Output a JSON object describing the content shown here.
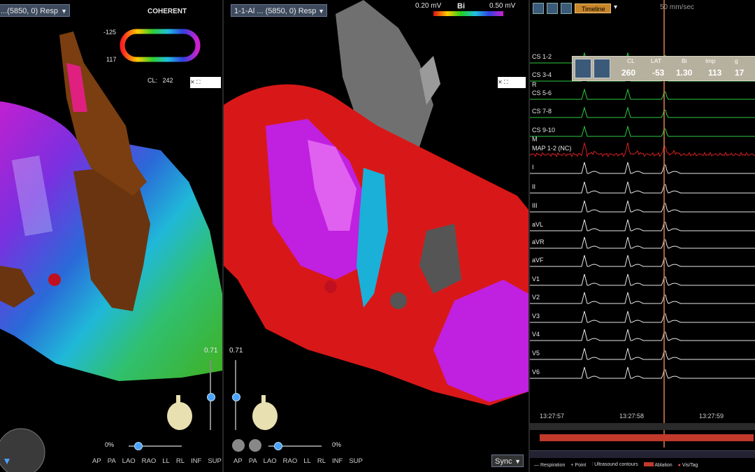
{
  "left_panel": {
    "map_select": "...(5850, 0) Resp",
    "coherent_title": "COHERENT",
    "lat_max": "-125",
    "lat_min": "117",
    "cl_label": "CL:",
    "cl_value": "242",
    "opacity_value": "0.71",
    "zoom_value": "0%",
    "views": [
      "AP",
      "PA",
      "LAO",
      "RAO",
      "LL",
      "RL",
      "INF",
      "SUP"
    ]
  },
  "middle_panel": {
    "map_select": "1-1-Al ... (5850, 0) Resp",
    "bi_min": "0.20 mV",
    "bi_label": "Bi",
    "bi_max": "0.50 mV",
    "opacity_value": "0.71",
    "zoom_value": "0%",
    "views": [
      "AP",
      "PA",
      "LAO",
      "RAO",
      "LL",
      "RL",
      "INF",
      "SUP"
    ],
    "sync_label": "Sync"
  },
  "ecg_panel": {
    "timeline_label": "Timeline",
    "speed_label": "50 mm/sec",
    "info": {
      "headers": [
        "CL",
        "LAT",
        "Bi",
        "Imp",
        "g"
      ],
      "values": [
        "260",
        "-53",
        "1.30",
        "113",
        "17"
      ]
    },
    "channels": [
      "CS 1-2",
      "CS 3-4",
      "R",
      "CS 5-6",
      "CS 7-8",
      "CS 9-10",
      "M",
      "MAP 1-2 (NC)",
      "I",
      "II",
      "III",
      "aVL",
      "aVR",
      "aVF",
      "V1",
      "V2",
      "V3",
      "V4",
      "V5",
      "V6"
    ],
    "times": [
      "13:27:57",
      "13:27:58",
      "13:27:59"
    ],
    "legend": [
      "Respiration",
      "Point",
      "Ultrasound contours",
      "Ablation",
      "VisiTag"
    ]
  },
  "colors": {
    "ablation": "#c0392b",
    "cursor": "#e0804a",
    "cs_trace": "#2ecc40",
    "map_trace": "#d62020"
  }
}
